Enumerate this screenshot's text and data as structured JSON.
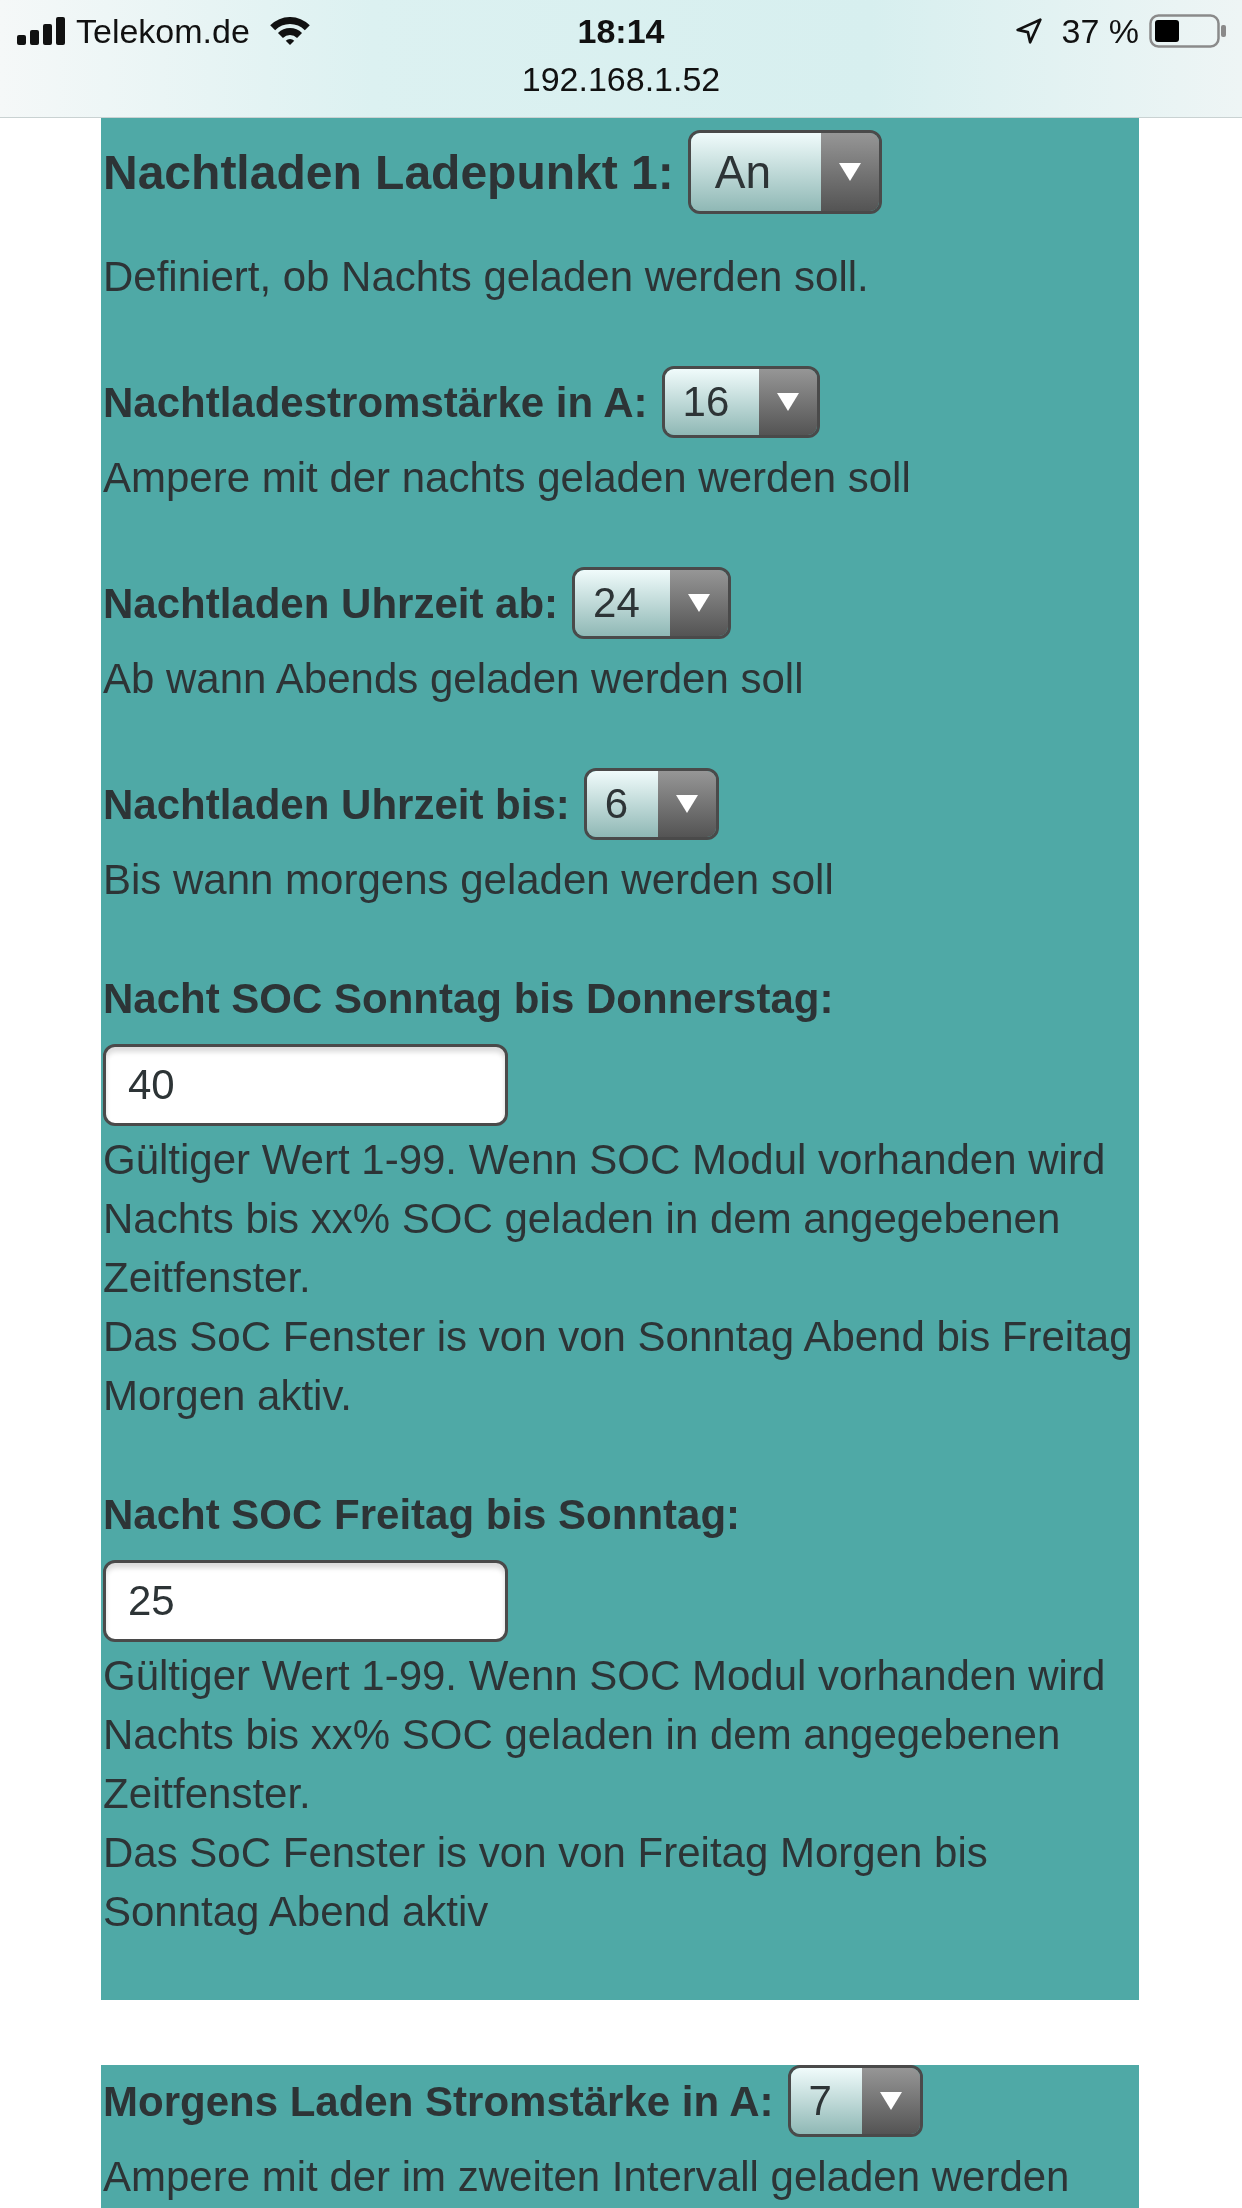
{
  "status_bar": {
    "carrier": "Telekom.de",
    "time": "18:14",
    "url": "192.168.1.52",
    "battery": "37 %"
  },
  "panels": [
    {
      "settings": [
        {
          "kind": "title-select",
          "label": "Nachtladen Ladepunkt 1:",
          "value": "An",
          "help": [
            "Definiert, ob Nachts geladen werden soll."
          ]
        },
        {
          "kind": "select",
          "label": "Nachtladestromstärke in A:",
          "value": "16",
          "help": [
            "Ampere mit der nachts geladen werden soll"
          ]
        },
        {
          "kind": "select",
          "label": "Nachtladen Uhrzeit ab:",
          "value": "24",
          "help": [
            "Ab wann Abends geladen werden soll"
          ]
        },
        {
          "kind": "select",
          "label": "Nachtladen Uhrzeit bis:",
          "value": "6",
          "help": [
            "Bis wann morgens geladen werden soll"
          ]
        },
        {
          "kind": "input",
          "label": "Nacht SOC Sonntag bis Donnerstag:",
          "value": "40",
          "help": [
            "Gültiger Wert 1-99. Wenn SOC Modul vorhanden wird Nachts bis xx% SOC geladen in dem angegebenen Zeitfenster.",
            "Das SoC Fenster is von von Sonntag Abend bis Freitag Morgen aktiv."
          ]
        },
        {
          "kind": "input",
          "label": "Nacht SOC Freitag bis Sonntag:",
          "value": "25",
          "help": [
            "Gültiger Wert 1-99. Wenn SOC Modul vorhanden wird Nachts bis xx% SOC geladen in dem angegebenen Zeitfenster.",
            "Das SoC Fenster is von von Freitag Morgen bis Sonntag Abend aktiv"
          ]
        }
      ]
    },
    {
      "settings": [
        {
          "kind": "select",
          "label": "Morgens Laden Stromstärke in A:",
          "value": "7",
          "help": [
            "Ampere mit der im zweiten Intervall geladen werden"
          ]
        }
      ]
    }
  ]
}
